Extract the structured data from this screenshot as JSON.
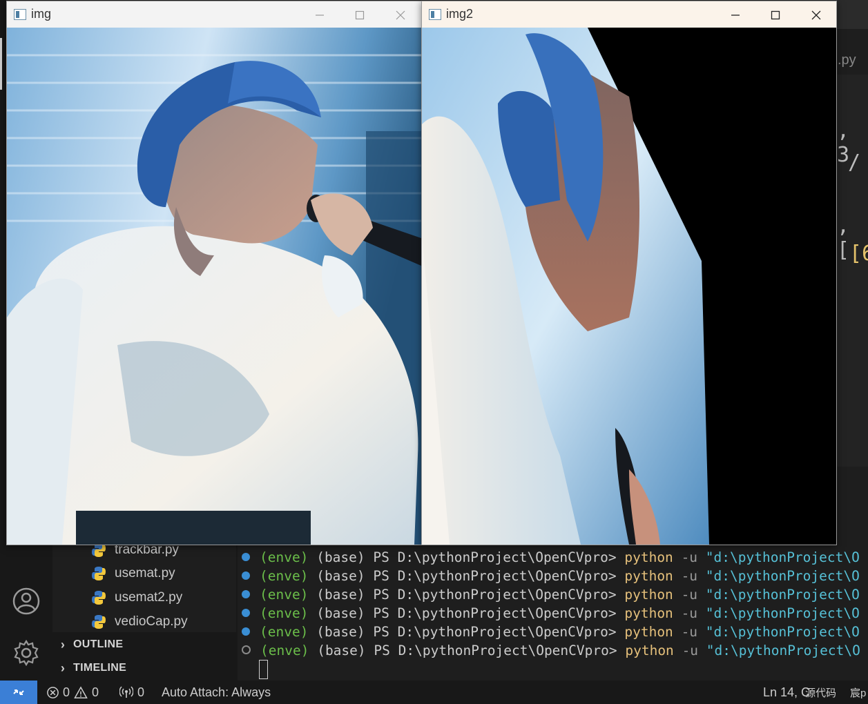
{
  "editor": {
    "tab_file_suffix": ".py",
    "code_fragments": [
      ", 3",
      "/",
      ", [",
      "[6"
    ]
  },
  "explorer": {
    "files": [
      "trackbar.py",
      "usemat.py",
      "usemat2.py",
      "vedioCap.py"
    ],
    "sections": [
      "OUTLINE",
      "TIMELINE"
    ]
  },
  "terminal": {
    "lines": [
      {
        "env": "(enve)",
        "base": "(base)",
        "prompt": "PS D:\\pythonProject\\OpenCVpro>",
        "cmd": "python",
        "flag": "-u",
        "arg": "\"d:\\pythonProject\\O"
      },
      {
        "env": "(enve)",
        "base": "(base)",
        "prompt": "PS D:\\pythonProject\\OpenCVpro>",
        "cmd": "python",
        "flag": "-u",
        "arg": "\"d:\\pythonProject\\O"
      },
      {
        "env": "(enve)",
        "base": "(base)",
        "prompt": "PS D:\\pythonProject\\OpenCVpro>",
        "cmd": "python",
        "flag": "-u",
        "arg": "\"d:\\pythonProject\\O"
      },
      {
        "env": "(enve)",
        "base": "(base)",
        "prompt": "PS D:\\pythonProject\\OpenCVpro>",
        "cmd": "python",
        "flag": "-u",
        "arg": "\"d:\\pythonProject\\O"
      },
      {
        "env": "(enve)",
        "base": "(base)",
        "prompt": "PS D:\\pythonProject\\OpenCVpro>",
        "cmd": "python",
        "flag": "-u",
        "arg": "\"d:\\pythonProject\\O"
      },
      {
        "env": "(enve)",
        "base": "(base)",
        "prompt": "PS D:\\pythonProject\\OpenCVpro>",
        "cmd": "python",
        "flag": "-u",
        "arg": "\"d:\\pythonProject\\O"
      }
    ]
  },
  "statusbar": {
    "errors": "0",
    "warnings": "0",
    "ports": "0",
    "auto_attach": "Auto Attach: Always",
    "position": "Ln 14, C",
    "source_label": "源代码",
    "extra": "宸p"
  },
  "windows": {
    "img": {
      "title": "img"
    },
    "img2": {
      "title": "img2"
    }
  },
  "colors": {
    "statusbar_remote": "#3b7fd6",
    "terminal_env": "#6bbe4a",
    "terminal_cmd": "#e5c07b",
    "terminal_arg": "#56c0d6"
  }
}
